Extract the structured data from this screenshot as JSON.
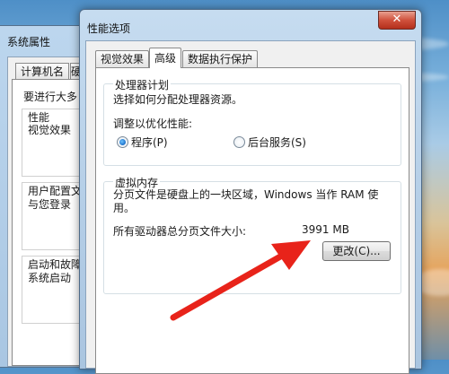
{
  "back_window": {
    "title": "系统属性",
    "tabs": [
      "计算机名",
      "硬"
    ],
    "lines": [
      "要进行大多",
      "性能",
      "视觉效果",
      "用户配置文",
      "与您登录",
      "启动和故障",
      "系统启动"
    ]
  },
  "front_window": {
    "title": "性能选项",
    "close_glyph": "✕",
    "tabs": [
      "视觉效果",
      "高级",
      "数据执行保护"
    ],
    "active_tab": "高级",
    "processor": {
      "legend": "处理器计划",
      "description": "选择如何分配处理器资源。",
      "optimize_label": "调整以优化性能:",
      "option_programs": "程序(P)",
      "option_background": "后台服务(S)",
      "selected": "程序(P)"
    },
    "virtual_memory": {
      "legend": "虚拟内存",
      "description": "分页文件是硬盘上的一块区域，Windows 当作 RAM 使用。",
      "total_label": "所有驱动器总分页文件大小:",
      "total_value": "3991 MB",
      "change_button": "更改(C)..."
    }
  },
  "annotation": {
    "arrow_color": "#e8231a"
  }
}
